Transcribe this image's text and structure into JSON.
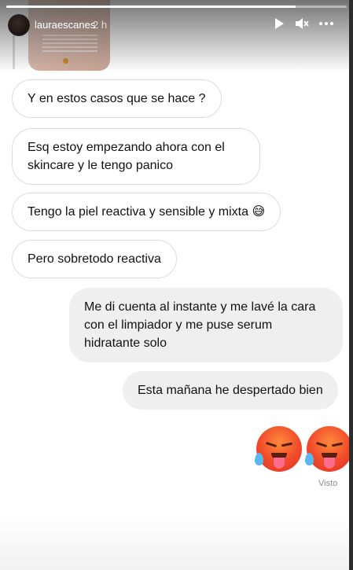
{
  "story": {
    "username": "lauraescanes",
    "time_ago": "2 h",
    "controls": {
      "play_icon": "play-icon",
      "mute_icon": "mute-icon",
      "more_icon": "more-icon"
    }
  },
  "messages": [
    {
      "side": "in",
      "text": "Y en estos casos que se hace ?"
    },
    {
      "side": "in",
      "text": "Esq estoy empezando ahora con el skincare y le tengo panico"
    },
    {
      "side": "in",
      "text": "Tengo la piel reactiva y sensible y mixta 😅"
    },
    {
      "side": "in",
      "text": "Pero sobretodo reactiva"
    },
    {
      "side": "out",
      "text": "Me di cuenta al instante y me lavé la cara con el limpiador y me puse serum hidratante solo"
    },
    {
      "side": "out",
      "text": "Esta mañana he despertado bien"
    }
  ],
  "reactions": [
    "hot-face-emoji",
    "hot-face-emoji"
  ],
  "seen_label": "Visto",
  "colors": {
    "incoming_bubble": "#ffffff",
    "outgoing_bubble": "#efefef",
    "text": "#111111",
    "seen": "#8e8e8e"
  }
}
